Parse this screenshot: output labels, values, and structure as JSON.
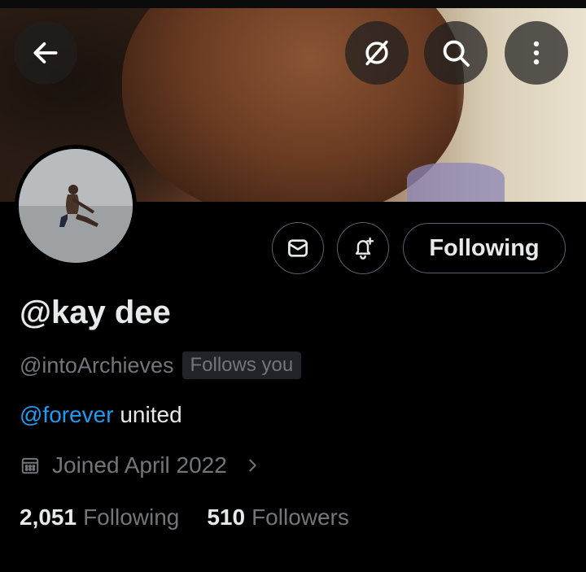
{
  "header": {
    "back_icon": "arrow-left-icon",
    "grok_icon": "grok-icon",
    "search_icon": "search-icon",
    "more_icon": "more-vertical-icon"
  },
  "profile": {
    "display_name": "@kay dee",
    "handle": "@intoArchieves",
    "follows_you_badge": "Follows you",
    "bio": {
      "mention": "@forever",
      "text": " united"
    },
    "joined": "Joined April 2022",
    "following_count": "2,051",
    "following_label": "Following",
    "followers_count": "510",
    "followers_label": "Followers"
  },
  "actions": {
    "message_icon": "envelope-icon",
    "notify_icon": "bell-plus-icon",
    "following_button": "Following"
  },
  "colors": {
    "background": "#000000",
    "text_primary": "#e7e9ea",
    "text_secondary": "#71767b",
    "link": "#1d9bf0",
    "border": "#536471"
  }
}
